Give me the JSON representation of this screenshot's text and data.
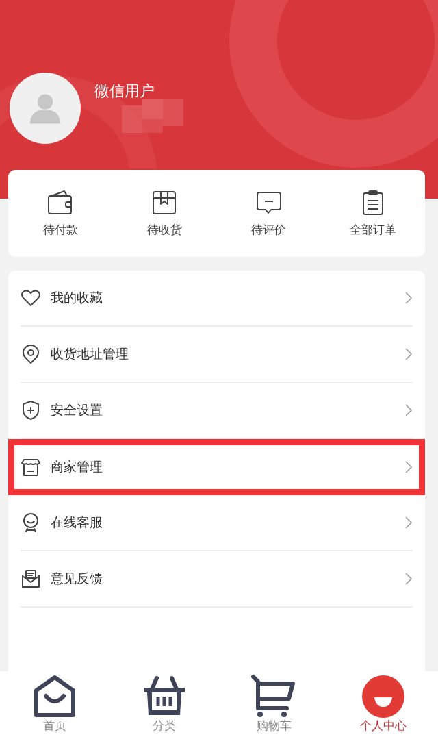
{
  "profile": {
    "name": "微信用户"
  },
  "orders": [
    {
      "label": "待付款",
      "kind": "wallet"
    },
    {
      "label": "待收货",
      "kind": "box"
    },
    {
      "label": "待评价",
      "kind": "comment"
    },
    {
      "label": "全部订单",
      "kind": "clipboard"
    }
  ],
  "menu": [
    {
      "label": "我的收藏",
      "kind": "heart",
      "highlighted": false
    },
    {
      "label": "收货地址管理",
      "kind": "pin",
      "highlighted": false
    },
    {
      "label": "安全设置",
      "kind": "shield",
      "highlighted": false
    },
    {
      "label": "商家管理",
      "kind": "store",
      "highlighted": true
    },
    {
      "label": "在线客服",
      "kind": "agent",
      "highlighted": false
    },
    {
      "label": "意见反馈",
      "kind": "mail",
      "highlighted": false
    }
  ],
  "tabs": [
    {
      "label": "首页",
      "kind": "home",
      "selected": false
    },
    {
      "label": "分类",
      "kind": "basket",
      "selected": false
    },
    {
      "label": "购物车",
      "kind": "cart",
      "selected": false
    },
    {
      "label": "个人中心",
      "kind": "user",
      "selected": true
    }
  ]
}
